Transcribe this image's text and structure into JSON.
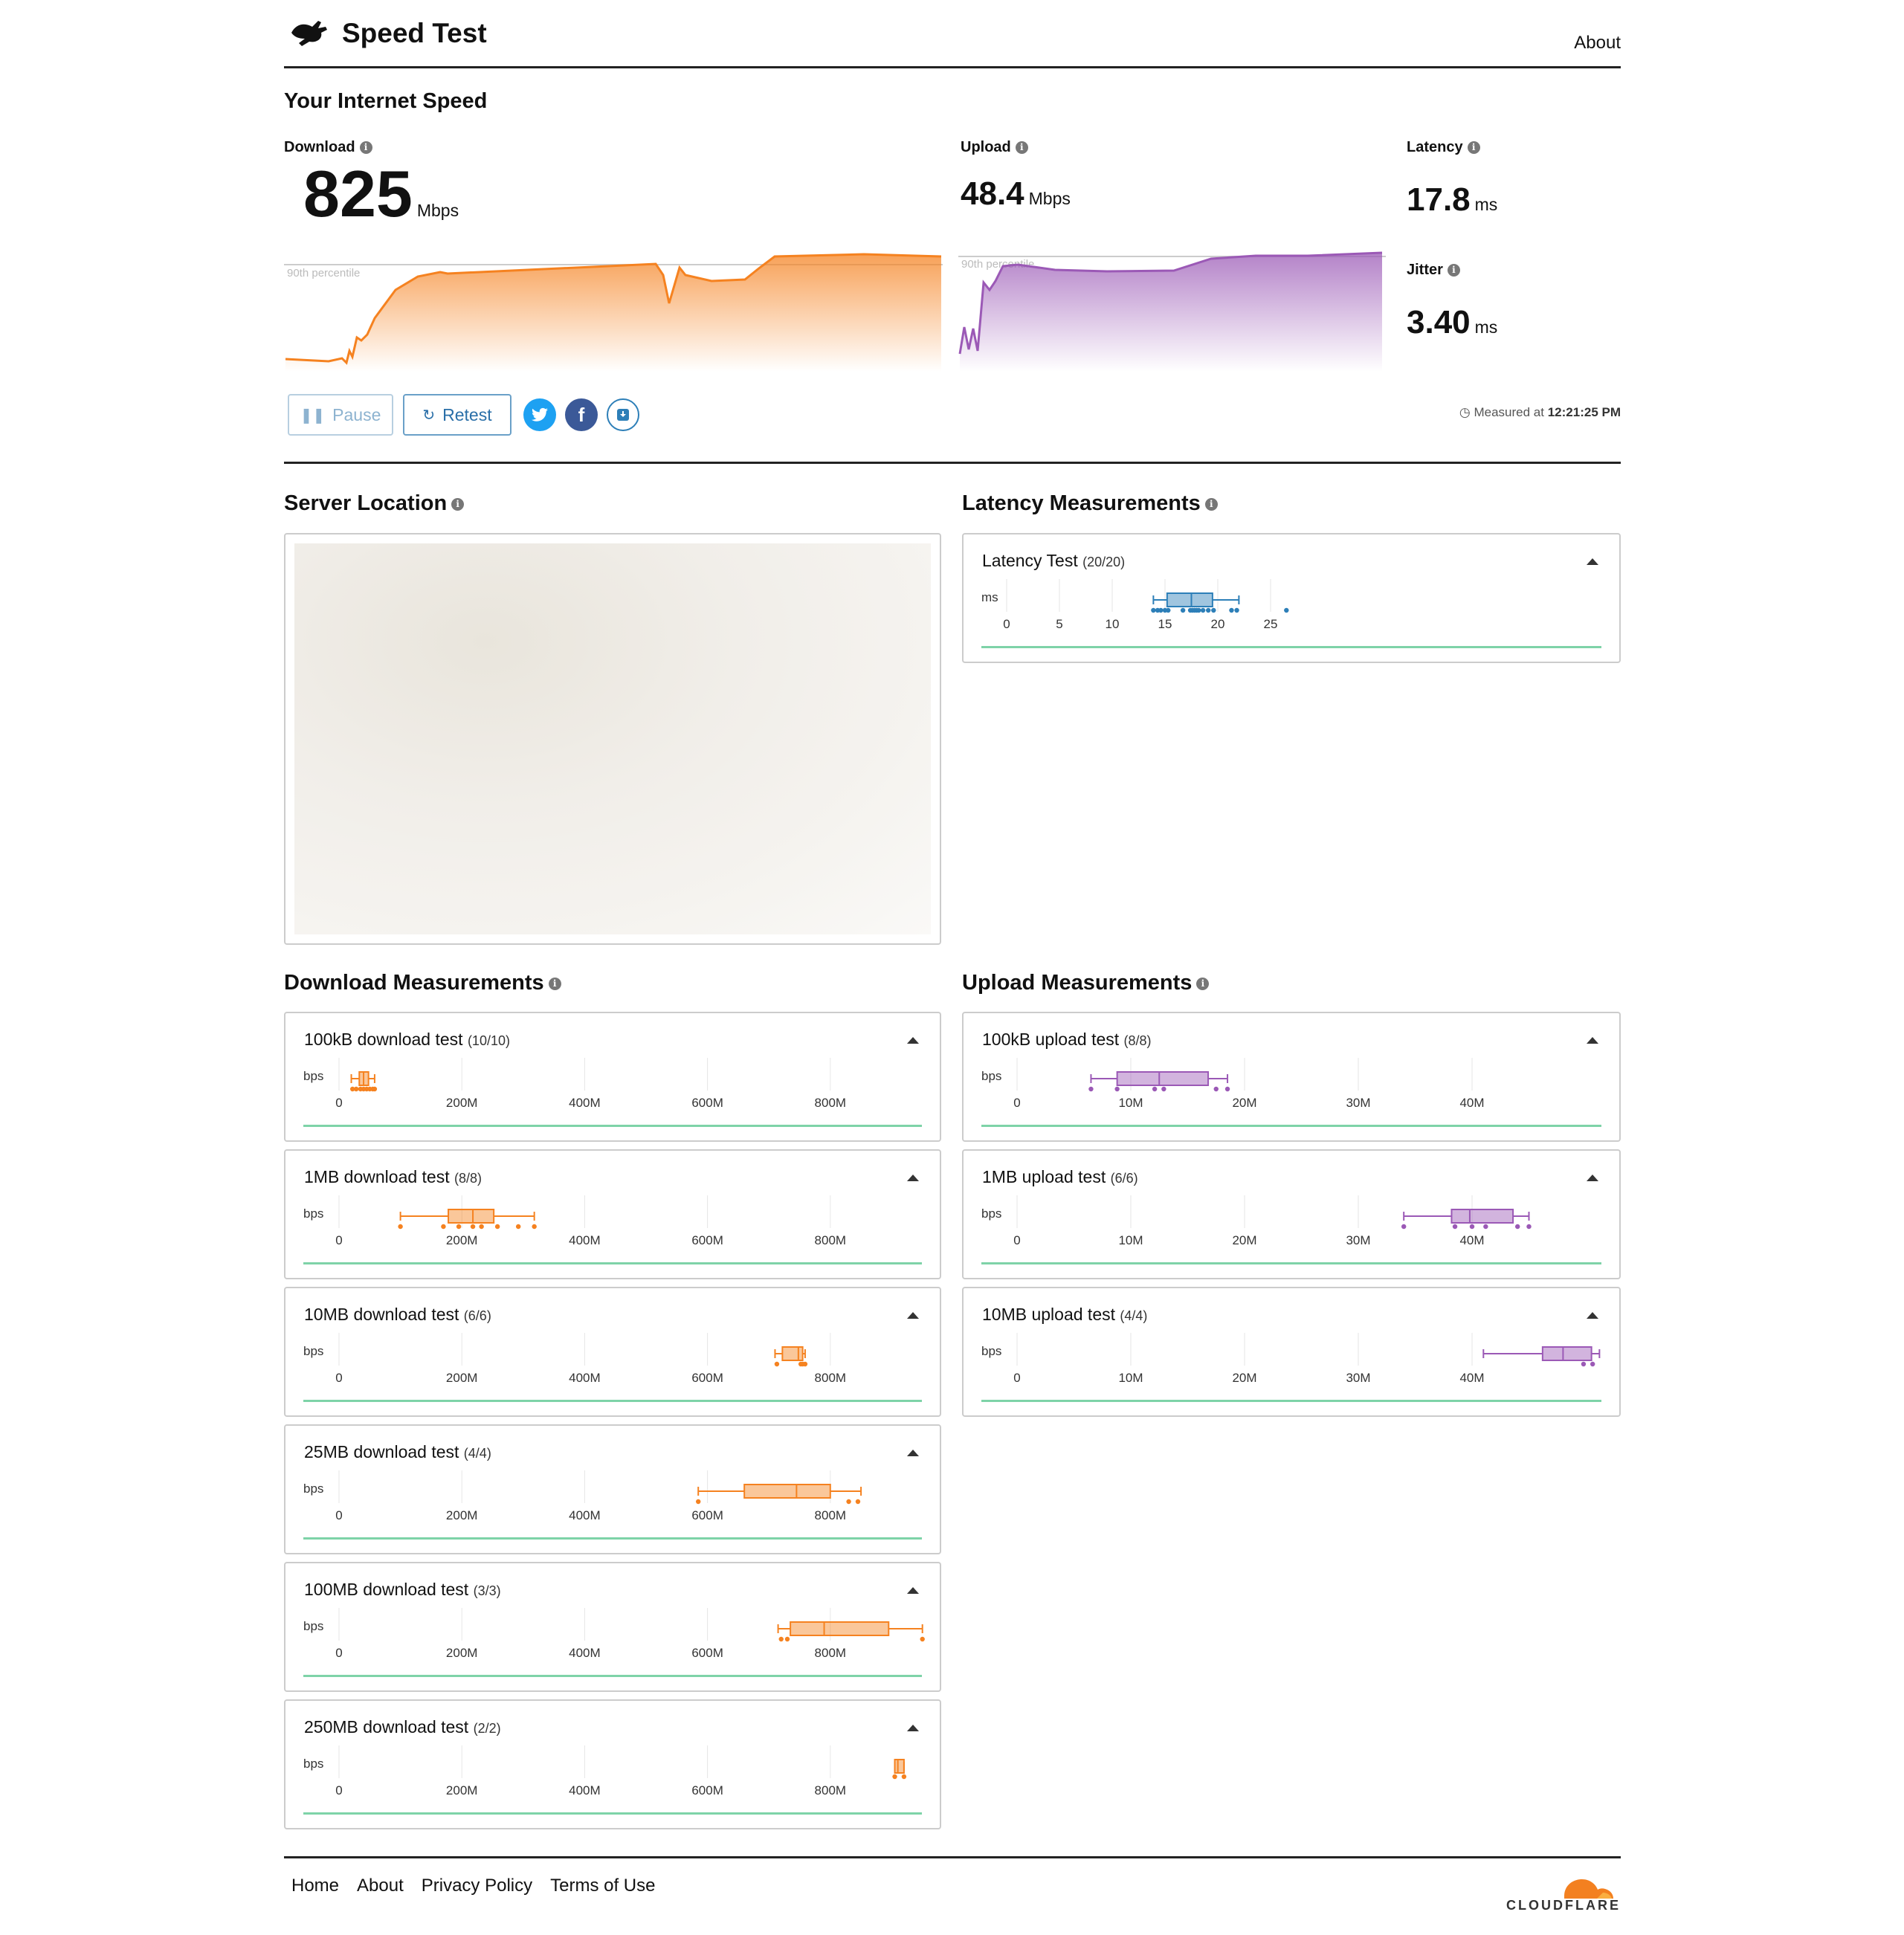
{
  "header": {
    "brand": "Speed Test",
    "about": "About"
  },
  "summary": {
    "title": "Your Internet Speed",
    "download": {
      "label": "Download",
      "value": "825",
      "unit": "Mbps"
    },
    "upload": {
      "label": "Upload",
      "value": "48.4",
      "unit": "Mbps"
    },
    "latency": {
      "label": "Latency",
      "value": "17.8",
      "unit": "ms"
    },
    "jitter": {
      "label": "Jitter",
      "value": "3.40",
      "unit": "ms"
    },
    "percentile_label": "90th percentile",
    "pause": "Pause",
    "retest": "Retest",
    "measured_prefix": "Measured at",
    "measured_time": "12:21:25 PM"
  },
  "colors": {
    "download": "#f58220",
    "upload": "#9b59b6",
    "latency": "#2d7fb8",
    "green": "#7ed3a8",
    "twitter": "#1da1f2",
    "facebook": "#3b5998"
  },
  "server": {
    "title": "Server Location"
  },
  "latency_section": {
    "title": "Latency Measurements",
    "panel": {
      "title": "Latency Test",
      "count": "(20/20)",
      "unit": "ms",
      "ticks": [
        "0",
        "5",
        "10",
        "15",
        "20",
        "25"
      ],
      "tick_values": [
        0,
        5,
        10,
        15,
        20,
        25
      ],
      "box": {
        "min": 13.9,
        "q1": 15.2,
        "median": 17.5,
        "q3": 19.5,
        "max": 22.0
      },
      "points": [
        13.9,
        14.3,
        14.6,
        15.0,
        15.3,
        16.7,
        17.4,
        17.6,
        17.8,
        18.0,
        18.2,
        18.6,
        19.1,
        19.6,
        21.3,
        21.8,
        26.5
      ]
    }
  },
  "download_section": {
    "title": "Download Measurements",
    "unit": "bps",
    "ticks": [
      "0",
      "200M",
      "400M",
      "600M",
      "800M"
    ],
    "tick_values": [
      0,
      200,
      400,
      600,
      800
    ],
    "panels": [
      {
        "title": "100kB download test",
        "count": "(10/10)",
        "box": {
          "min": 20,
          "q1": 33,
          "median": 40,
          "q3": 48,
          "max": 58
        },
        "points": [
          22,
          28,
          35,
          40,
          45,
          50,
          55,
          58
        ]
      },
      {
        "title": "1MB download test",
        "count": "(8/8)",
        "box": {
          "min": 100,
          "q1": 178,
          "median": 218,
          "q3": 252,
          "max": 318
        },
        "points": [
          100,
          170,
          195,
          218,
          232,
          258,
          292,
          318
        ]
      },
      {
        "title": "10MB download test",
        "count": "(6/6)",
        "box": {
          "min": 710,
          "q1": 722,
          "median": 748,
          "q3": 755,
          "max": 759
        },
        "points": [
          713,
          752,
          755,
          759
        ]
      },
      {
        "title": "25MB download test",
        "count": "(4/4)",
        "box": {
          "min": 585,
          "q1": 660,
          "median": 745,
          "q3": 800,
          "max": 850
        },
        "points": [
          585,
          830,
          845
        ]
      },
      {
        "title": "100MB download test",
        "count": "(3/3)",
        "box": {
          "min": 715,
          "q1": 735,
          "median": 790,
          "q3": 895,
          "max": 950
        },
        "points": [
          720,
          730,
          950
        ]
      },
      {
        "title": "250MB download test",
        "count": "(2/2)",
        "box": {
          "min": 905,
          "q1": 905,
          "median": 910,
          "q3": 920,
          "max": 920
        },
        "points": [
          905,
          920
        ]
      }
    ]
  },
  "upload_section": {
    "title": "Upload Measurements",
    "unit": "bps",
    "ticks": [
      "0",
      "10M",
      "20M",
      "30M",
      "40M"
    ],
    "tick_values": [
      0,
      10,
      20,
      30,
      40
    ],
    "panels": [
      {
        "title": "100kB upload test",
        "count": "(8/8)",
        "box": {
          "min": 6.5,
          "q1": 8.8,
          "median": 12.5,
          "q3": 16.8,
          "max": 18.5
        },
        "points": [
          6.5,
          8.8,
          12.1,
          12.9,
          17.5,
          18.5
        ]
      },
      {
        "title": "1MB upload test",
        "count": "(6/6)",
        "box": {
          "min": 34.0,
          "q1": 38.2,
          "median": 39.8,
          "q3": 43.6,
          "max": 45.0
        },
        "points": [
          34.0,
          38.5,
          40.0,
          41.2,
          44.0,
          45.0
        ]
      },
      {
        "title": "10MB upload test",
        "count": "(4/4)",
        "box": {
          "min": 41.0,
          "q1": 46.2,
          "median": 48.0,
          "q3": 50.5,
          "max": 51.2
        },
        "points": [
          49.8,
          50.6
        ]
      }
    ]
  },
  "footer": {
    "links": [
      "Home",
      "About",
      "Privacy Policy",
      "Terms of Use"
    ],
    "cloudflare": "CLOUDFLARE"
  }
}
